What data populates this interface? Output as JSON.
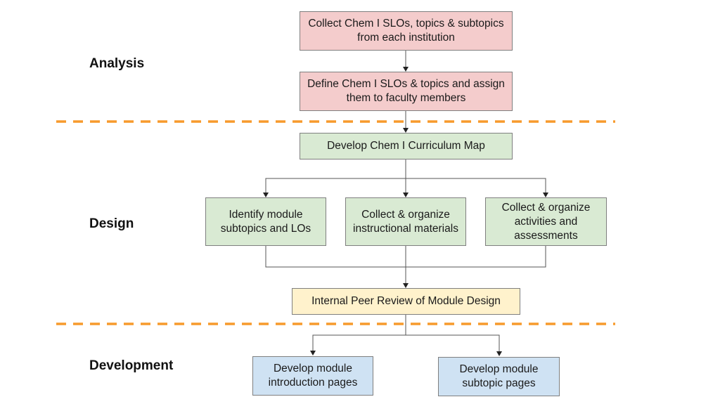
{
  "phases": {
    "analysis": "Analysis",
    "design": "Design",
    "development": "Development"
  },
  "colors": {
    "divider": "#f79a2c",
    "analysis_fill": "#f4cccc",
    "design_fill": "#d9ead3",
    "review_fill": "#fff2cc",
    "development_fill": "#cfe2f3",
    "connector": "#555555"
  },
  "boxes": {
    "collect_slos": "Collect Chem I SLOs, topics & subtopics from each institution",
    "define_slos": "Define Chem I SLOs & topics and assign them to faculty members",
    "curriculum_map": "Develop Chem I Curriculum Map",
    "identify_subtopics": "Identify module subtopics and LOs",
    "instructional_materials": "Collect & organize instructional materials",
    "activities_assessments": "Collect & organize activities and assessments",
    "peer_review": "Internal Peer Review of Module Design",
    "intro_pages": "Develop module introduction pages",
    "subtopic_pages": "Develop module subtopic pages"
  }
}
